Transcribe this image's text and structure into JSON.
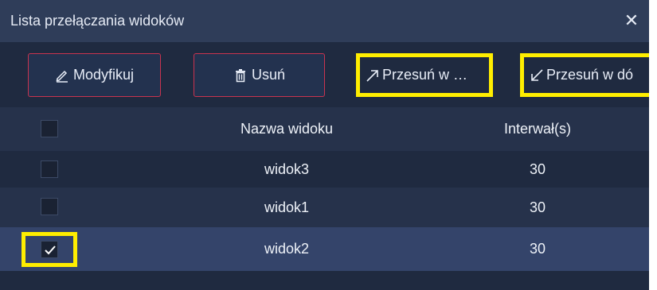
{
  "dialog": {
    "title": "Lista przełączania widoków",
    "close_symbol": "✕"
  },
  "toolbar": {
    "modify_label": "Modyfikuj",
    "delete_label": "Usuń",
    "move_up_label": "Przesuń w …",
    "move_down_label": "Przesuń w dó",
    "icons": [
      "pencil-icon",
      "trash-icon",
      "arrow-up-right-icon",
      "arrow-down-left-icon"
    ]
  },
  "table": {
    "headers": {
      "name": "Nazwa widoku",
      "interval": "Interwał(s)"
    },
    "rows": [
      {
        "name": "widok3",
        "interval": "30",
        "checked": false
      },
      {
        "name": "widok1",
        "interval": "30",
        "checked": false
      },
      {
        "name": "widok2",
        "interval": "30",
        "checked": true
      }
    ]
  },
  "colors": {
    "background": "#1f2a40",
    "titlebar": "#2f3d59",
    "button_border": "#c9334f",
    "highlight": "#ffee00",
    "selected_row": "#34446a"
  }
}
